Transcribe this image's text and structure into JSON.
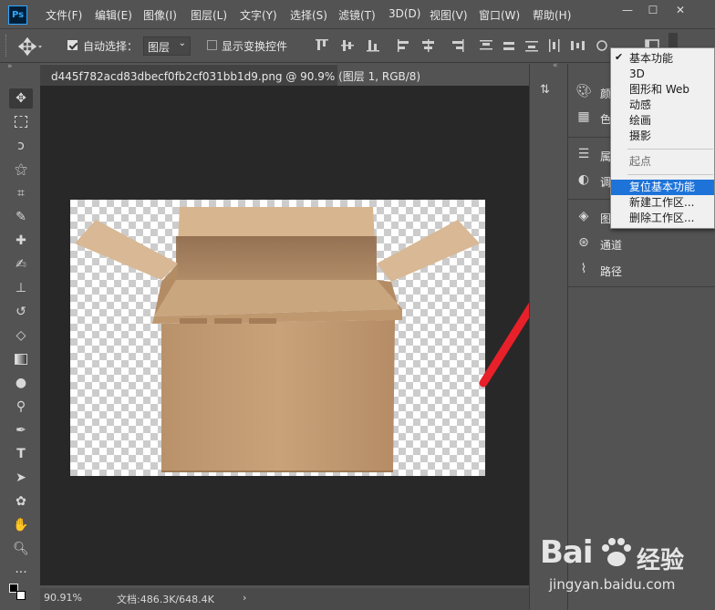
{
  "app": {
    "logo": "Ps"
  },
  "menubar": {
    "items": [
      "文件(F)",
      "编辑(E)",
      "图像(I)",
      "图层(L)",
      "文字(Y)",
      "选择(S)",
      "滤镜(T)",
      "3D(D)",
      "视图(V)",
      "窗口(W)",
      "帮助(H)"
    ]
  },
  "window_controls": {
    "minimize": "—",
    "maximize": "☐",
    "close": "✕"
  },
  "options": {
    "auto_select_label": "自动选择：",
    "layer_dropdown": "图层",
    "show_transform_label": "显示变换控件"
  },
  "document": {
    "tab_title": "d445f782acd83dbecf0fb2cf031bb1d9.png @ 90.9% (图层 1, RGB/8)",
    "zoom": "90.91%",
    "doc_info": "文档:486.3K/648.4K"
  },
  "panels": {
    "rows": [
      {
        "icon": "palette-icon",
        "label": "颜"
      },
      {
        "icon": "swatches-icon",
        "label": "色"
      },
      {
        "icon": "properties-icon",
        "label": "属"
      },
      {
        "icon": "adjustments-icon",
        "label": "调"
      },
      {
        "icon": "layers-icon",
        "label": "图"
      },
      {
        "icon": "channels-icon",
        "label": "通道"
      },
      {
        "icon": "paths-icon",
        "label": "路径"
      }
    ]
  },
  "workspace_menu": {
    "items": [
      {
        "label": "基本功能",
        "checked": "✔"
      },
      {
        "label": "3D"
      },
      {
        "label": "图形和 Web"
      },
      {
        "label": "动感"
      },
      {
        "label": "绘画"
      },
      {
        "label": "摄影"
      },
      {
        "label": "起点"
      },
      {
        "label": "复位基本功能"
      },
      {
        "label": "新建工作区..."
      },
      {
        "label": "删除工作区..."
      }
    ]
  },
  "watermark": {
    "brand_left": "Bai",
    "brand_right": "经验",
    "url": "jingyan.baidu.com"
  },
  "colors": {
    "accent": "#1e73d9",
    "arrow": "#e8202a",
    "box": "#c9a27a"
  }
}
